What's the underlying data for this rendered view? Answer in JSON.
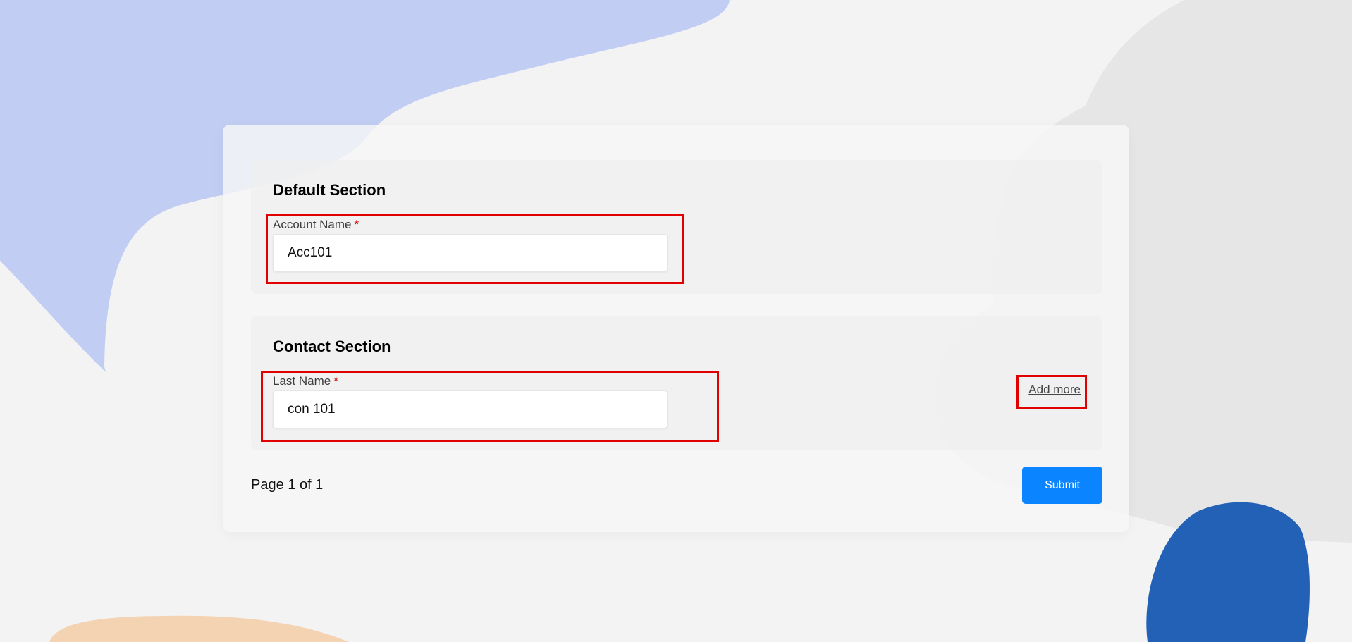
{
  "theme": {
    "accent": "#0a84ff",
    "required_color": "#d40000",
    "highlight_color": "#e00000",
    "blob_lavender": "#c1cdf3",
    "blob_blue": "#2361b6",
    "blob_peach": "#f4d3b3",
    "blob_grey": "#e6e6e6"
  },
  "form": {
    "sections": [
      {
        "title": "Default Section",
        "fields": [
          {
            "label": "Account Name",
            "required_mark": "*",
            "value": "Acc101"
          }
        ]
      },
      {
        "title": "Contact Section",
        "fields": [
          {
            "label": "Last Name",
            "required_mark": "*",
            "value": "con 101"
          }
        ],
        "add_more_label": "Add more"
      }
    ],
    "footer": {
      "page_label": "Page 1 of 1",
      "submit_label": "Submit"
    }
  }
}
